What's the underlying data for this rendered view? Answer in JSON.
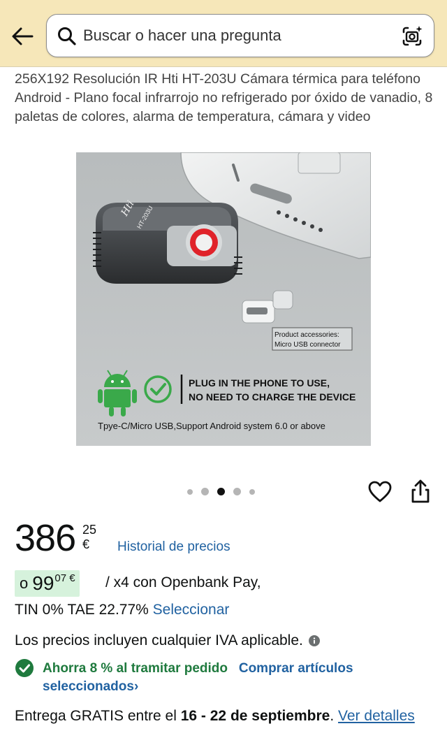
{
  "search": {
    "placeholder": "Buscar o hacer una pregunta"
  },
  "product": {
    "title": "256X192 Resolución IR Hti HT-203U Cámara térmica para teléfono Android - Plano focal infrarrojo no refrigerado por óxido de vanadio, 8 paletas de colores, alarma de temperatura, cámara y video",
    "image": {
      "device_brand": "Hti",
      "device_model": "HT-203U",
      "accessories_note_line1": "Product accessories:",
      "accessories_note_line2": "Micro USB connector",
      "plug_line1": "PLUG IN THE PHONE TO USE,",
      "plug_line2": "NO NEED TO CHARGE THE DEVICE",
      "support_line": "Tpye-C/Micro USB,Support Android system 6.0 or above"
    },
    "carousel": {
      "count": 5,
      "active_index": 2
    }
  },
  "price": {
    "whole": "386",
    "fraction": "25 €",
    "history_link": "Historial de precios"
  },
  "financing": {
    "prefix": "o",
    "whole": "99",
    "fraction": "07 €",
    "rest": "/ x4 con Openbank Pay,",
    "tin_text": "TIN 0% TAE 22.77%",
    "select_link": "Seleccionar"
  },
  "vat_note": "Los precios incluyen cualquier IVA aplicable.",
  "savings": {
    "text": "Ahorra 8 % al tramitar pedido",
    "link": "Comprar artículos seleccionados",
    "chevron": "›"
  },
  "delivery": {
    "prefix": "Entrega GRATIS entre el",
    "dates": "16 - 22 de septiembre",
    "suffix": ".",
    "link": "Ver detalles"
  },
  "colors": {
    "header_bg": "#f6e7b9",
    "link": "#2162a1",
    "savings_green": "#1f7a3e",
    "financing_bg": "#d6f2dc",
    "lens_red": "#e0232a",
    "android_green": "#3aa94a"
  }
}
